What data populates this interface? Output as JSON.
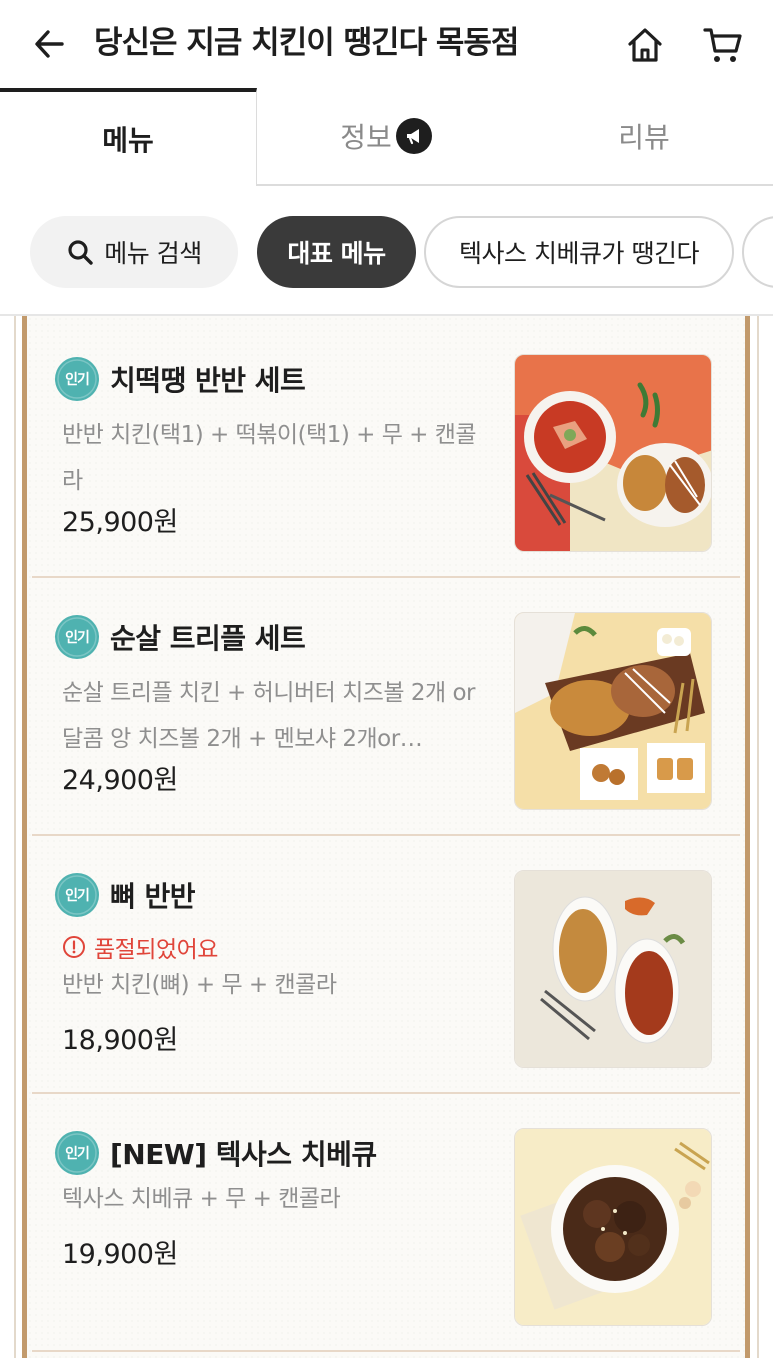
{
  "header": {
    "store_name": "당신은 지금 치킨이 땡긴다 목동점",
    "back_icon": "arrow-left-icon",
    "home_icon": "home-icon",
    "cart_icon": "cart-icon"
  },
  "tabs": [
    {
      "label": "메뉴",
      "active": true
    },
    {
      "label": "정보",
      "active": false
    },
    {
      "label": "리뷰",
      "active": false
    }
  ],
  "chips": {
    "search": "메뉴 검색",
    "representative": "대표 메뉴",
    "texas": "텍사스 치베큐가 땡긴다"
  },
  "colors": {
    "badge": "#4fb2b0",
    "soldout": "#e0453a",
    "board_frame": "#c29a6c",
    "chip_active": "#3a3a3a"
  },
  "menu_items": [
    {
      "badge": "인기",
      "name": "치떡땡 반반 세트",
      "description": "반반 치킨(택1) + 떡볶이(택1) + 무 + 캔콜라",
      "price": "25,900원",
      "image": "chicken-tteokbokki-set-photo"
    },
    {
      "badge": "인기",
      "name": "순살 트리플 세트",
      "description": "순살 트리플 치킨 + 허니버터 치즈볼 2개 or달콤 앙 치즈볼 2개 + 멘보샤 2개or…",
      "price": "24,900원",
      "image": "boneless-triple-set-photo"
    },
    {
      "badge": "인기",
      "name": "뼈 반반",
      "status": "품절되었어요",
      "description": "반반 치킨(뼈) + 무 + 캔콜라",
      "price": "18,900원",
      "image": "bone-half-half-photo"
    },
    {
      "badge": "인기",
      "name": "[NEW] 텍사스 치베큐",
      "description": "텍사스 치베큐 + 무 + 캔콜라",
      "price": "19,900원",
      "image": "texas-chibbq-photo"
    }
  ]
}
